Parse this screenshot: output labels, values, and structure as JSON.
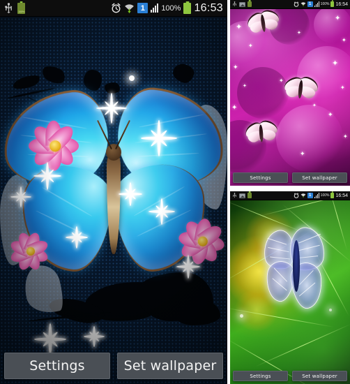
{
  "app": {
    "type": "android-live-wallpaper-preview",
    "panel_count": 3
  },
  "statusbar_main": {
    "usb_icon": "usb-icon",
    "battery_level_label": "100%",
    "alarm_icon": "alarm-clock-icon",
    "wifi_icon": "wifi-icon",
    "notification_count": "1",
    "signal_icon": "signal-bars-icon",
    "battery_percent": "100%",
    "battery_icon": "battery-icon",
    "clock": "16:53"
  },
  "statusbar_purple": {
    "usb_icon": "usb-icon",
    "gallery_icon": "gallery-icon",
    "battery_left_icon": "battery-icon",
    "alarm_icon": "alarm-clock-icon",
    "wifi_icon": "wifi-icon",
    "notification_count": "1",
    "signal_icon": "signal-bars-icon",
    "battery_percent": "100%",
    "battery_icon": "battery-icon",
    "clock": "16:54"
  },
  "statusbar_green": {
    "usb_icon": "usb-icon",
    "gallery_icon": "gallery-icon",
    "battery_left_icon": "battery-icon",
    "alarm_icon": "alarm-clock-icon",
    "wifi_icon": "wifi-icon",
    "notification_count": "1",
    "signal_icon": "signal-bars-icon",
    "battery_percent": "100%",
    "battery_icon": "battery-icon",
    "clock": "16:54"
  },
  "panel_main": {
    "name": "blue-butterfly-wallpaper",
    "description": "Blue morpho butterfly with pink cosmos flowers on dark blue halftone grunge background",
    "settings_label": "Settings",
    "set_wallpaper_label": "Set wallpaper"
  },
  "panel_purple": {
    "name": "purple-butterflies-wallpaper",
    "description": "Three white-pink butterflies on magenta bokeh background with sparkle stars",
    "settings_label": "Settings",
    "set_wallpaper_label": "Set wallpaper"
  },
  "panel_green": {
    "name": "neon-butterfly-wallpaper",
    "description": "Neon fractal blue butterfly on green background with yellow flower",
    "settings_label": "Settings",
    "set_wallpaper_label": "Set wallpaper"
  },
  "colors": {
    "status_bar_bg": "#0d0d0d",
    "button_bg": "#4a4f55",
    "button_text": "#f4f4f4",
    "battery_green": "#8ec63f",
    "notification_blue": "#2a7fd4",
    "wallpaper_blue": "#0b2f5c",
    "wallpaper_purple": "#d11fae",
    "wallpaper_green": "#3fae1d"
  }
}
